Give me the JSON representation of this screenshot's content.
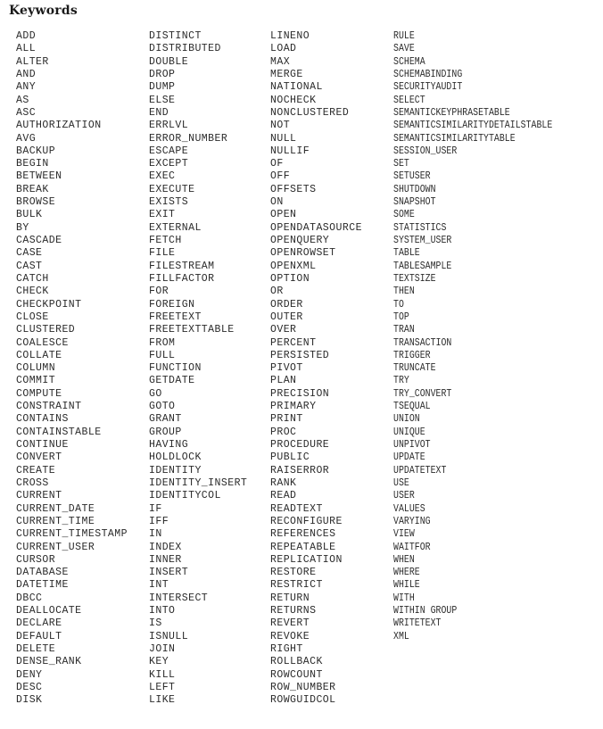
{
  "page": {
    "title": "Keywords",
    "text_color": "#2b2b2b",
    "title_color": "#1a1a1a",
    "background_color": "#ffffff"
  },
  "columns": [
    {
      "id": "col-1",
      "keywords": [
        "ADD",
        "ALL",
        "ALTER",
        "AND",
        "ANY",
        "AS",
        "ASC",
        "AUTHORIZATION",
        "AVG",
        "BACKUP",
        "BEGIN",
        "BETWEEN",
        "BREAK",
        "BROWSE",
        "BULK",
        "BY",
        "CASCADE",
        "CASE",
        "CAST",
        "CATCH",
        "CHECK",
        "CHECKPOINT",
        "CLOSE",
        "CLUSTERED",
        "COALESCE",
        "COLLATE",
        "COLUMN",
        "COMMIT",
        "COMPUTE",
        "CONSTRAINT",
        "CONTAINS",
        "CONTAINSTABLE",
        "CONTINUE",
        "CONVERT",
        "CREATE",
        "CROSS",
        "CURRENT",
        "CURRENT_DATE",
        "CURRENT_TIME",
        "CURRENT_TIMESTAMP",
        "CURRENT_USER",
        "CURSOR",
        "DATABASE",
        "DATETIME",
        "DBCC",
        "DEALLOCATE",
        "DECLARE",
        "DEFAULT",
        "DELETE",
        "DENSE_RANK",
        "DENY",
        "DESC",
        "DISK"
      ]
    },
    {
      "id": "col-2",
      "keywords": [
        "DISTINCT",
        "DISTRIBUTED",
        "DOUBLE",
        "DROP",
        "DUMP",
        "ELSE",
        "END",
        "ERRLVL",
        "ERROR_NUMBER",
        "ESCAPE",
        "EXCEPT",
        "EXEC",
        "EXECUTE",
        "EXISTS",
        "EXIT",
        "EXTERNAL",
        "FETCH",
        "FILE",
        "FILESTREAM",
        "FILLFACTOR",
        "FOR",
        "FOREIGN",
        "FREETEXT",
        "FREETEXTTABLE",
        "FROM",
        "FULL",
        "FUNCTION",
        "GETDATE",
        "GO",
        "GOTO",
        "GRANT",
        "GROUP",
        "HAVING",
        "HOLDLOCK",
        "IDENTITY",
        "IDENTITY_INSERT",
        "IDENTITYCOL",
        "IF",
        "IFF",
        "IN",
        "INDEX",
        "INNER",
        "INSERT",
        "INT",
        "INTERSECT",
        "INTO",
        "IS",
        "ISNULL",
        "JOIN",
        "KEY",
        "KILL",
        "LEFT",
        "LIKE"
      ]
    },
    {
      "id": "col-3",
      "keywords": [
        "LINENO",
        "LOAD",
        "MAX",
        "MERGE",
        "NATIONAL",
        "NOCHECK",
        "NONCLUSTERED",
        "NOT",
        "NULL",
        "NULLIF",
        "OF",
        "OFF",
        "OFFSETS",
        "ON",
        "OPEN",
        "OPENDATASOURCE",
        "OPENQUERY",
        "OPENROWSET",
        "OPENXML",
        "OPTION",
        "OR",
        "ORDER",
        "OUTER",
        "OVER",
        "PERCENT",
        "PERSISTED",
        "PIVOT",
        "PLAN",
        "PRECISION",
        "PRIMARY",
        "PRINT",
        "PROC",
        "PROCEDURE",
        "PUBLIC",
        "RAISERROR",
        "RANK",
        "READ",
        "READTEXT",
        "RECONFIGURE",
        "REFERENCES",
        "REPEATABLE",
        "REPLICATION",
        "RESTORE",
        "RESTRICT",
        "RETURN",
        "RETURNS",
        "REVERT",
        "REVOKE",
        "RIGHT",
        "ROLLBACK",
        "ROWCOUNT",
        "ROW_NUMBER",
        "ROWGUIDCOL"
      ]
    },
    {
      "id": "col-4",
      "keywords": [
        "RULE",
        "SAVE",
        "SCHEMA",
        "SCHEMABINDING",
        "SECURITYAUDIT",
        "SELECT",
        "SEMANTICKEYPHRASETABLE",
        "SEMANTICSIMILARITYDETAILSTABLE",
        "SEMANTICSIMILARITYTABLE",
        "SESSION_USER",
        "SET",
        "SETUSER",
        "SHUTDOWN",
        "SNAPSHOT",
        "SOME",
        "STATISTICS",
        "SYSTEM_USER",
        "TABLE",
        "TABLESAMPLE",
        "TEXTSIZE",
        "THEN",
        "TO",
        "TOP",
        "TRAN",
        "TRANSACTION",
        "TRIGGER",
        "TRUNCATE",
        "TRY",
        "TRY_CONVERT",
        "TSEQUAL",
        "UNION",
        "UNIQUE",
        "UNPIVOT",
        "UPDATE",
        "UPDATETEXT",
        "USE",
        "USER",
        "VALUES",
        "VARYING",
        "VIEW",
        "WAITFOR",
        "WHEN",
        "WHERE",
        "WHILE",
        "WITH",
        "WITHIN GROUP",
        "WRITETEXT",
        "XML"
      ]
    }
  ]
}
